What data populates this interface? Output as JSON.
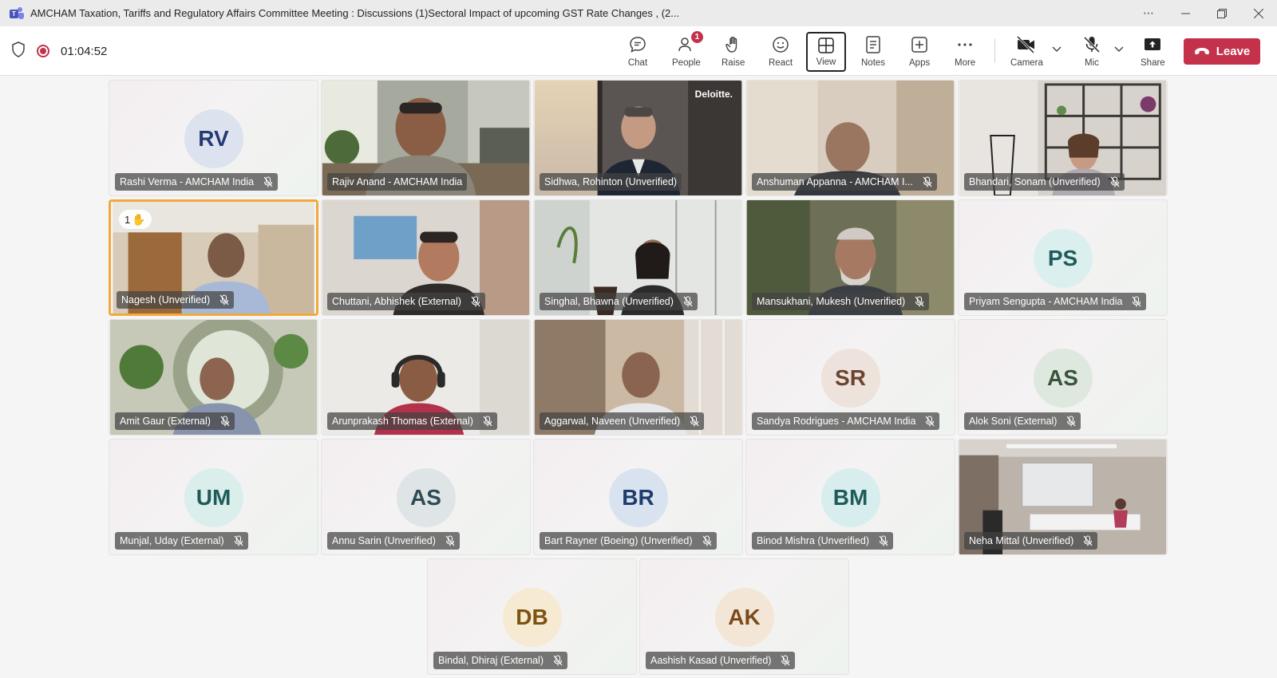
{
  "window": {
    "title": "AMCHAM Taxation, Tariffs and Regulatory Affairs Committee Meeting : Discussions (1)Sectoral Impact of upcoming GST Rate Changes , (2..."
  },
  "toolbar": {
    "timer": "01:04:52",
    "buttons": {
      "chat": "Chat",
      "people": "People",
      "people_badge": "1",
      "raise": "Raise",
      "react": "React",
      "view": "View",
      "notes": "Notes",
      "apps": "Apps",
      "more": "More",
      "camera": "Camera",
      "mic": "Mic",
      "share": "Share"
    },
    "leave_label": "Leave"
  },
  "participants": [
    {
      "name": "Rashi Verma - AMCHAM India",
      "initials": "RV",
      "type": "avatar",
      "avatar_bg": "#dde3ee",
      "avatar_fg": "#243a73"
    },
    {
      "name": "Rajiv Anand - AMCHAM India",
      "type": "video"
    },
    {
      "name": "Sidhwa, Rohinton (Unverified)",
      "type": "video",
      "brand": "Deloitte."
    },
    {
      "name": "Anshuman Appanna - AMCHAM I...",
      "type": "video"
    },
    {
      "name": "Bhandari, Sonam (Unverified)",
      "type": "video"
    },
    {
      "name": "Nagesh (Unverified)",
      "type": "video",
      "hand_count": "1"
    },
    {
      "name": "Chuttani, Abhishek (External)",
      "type": "video"
    },
    {
      "name": "Singhal, Bhawna (Unverified)",
      "type": "video"
    },
    {
      "name": "Mansukhani, Mukesh (Unverified)",
      "type": "video"
    },
    {
      "name": "Priyam Sengupta - AMCHAM India",
      "initials": "PS",
      "type": "avatar",
      "avatar_bg": "#dcefef",
      "avatar_fg": "#1f5c5c"
    },
    {
      "name": "Amit Gaur (External)",
      "type": "video"
    },
    {
      "name": "Arunprakash Thomas (External)",
      "type": "video"
    },
    {
      "name": "Aggarwal, Naveen (Unverified)",
      "type": "video"
    },
    {
      "name": "Sandya Rodrigues - AMCHAM India",
      "initials": "SR",
      "type": "avatar",
      "avatar_bg": "#ede3dc",
      "avatar_fg": "#6b4430"
    },
    {
      "name": "Alok Soni (External)",
      "initials": "AS",
      "type": "avatar",
      "avatar_bg": "#dfe8df",
      "avatar_fg": "#38543a"
    },
    {
      "name": "Munjal, Uday (External)",
      "initials": "UM",
      "type": "avatar",
      "avatar_bg": "#daeeec",
      "avatar_fg": "#1f5c58"
    },
    {
      "name": "Annu Sarin (Unverified)",
      "initials": "AS",
      "type": "avatar",
      "avatar_bg": "#dfe5e6",
      "avatar_fg": "#2e4a55"
    },
    {
      "name": "Bart Rayner (Boeing) (Unverified)",
      "initials": "BR",
      "type": "avatar",
      "avatar_bg": "#d9e3f0",
      "avatar_fg": "#1f3d6b"
    },
    {
      "name": "Binod Mishra (Unverified)",
      "initials": "BM",
      "type": "avatar",
      "avatar_bg": "#d8eeee",
      "avatar_fg": "#1f5a5c"
    },
    {
      "name": "Neha Mittal (Unverified)",
      "type": "video"
    },
    {
      "name": "Bindal, Dhiraj (External)",
      "initials": "DB",
      "type": "avatar",
      "avatar_bg": "#f6ead2",
      "avatar_fg": "#7a5410"
    },
    {
      "name": "Aashish Kasad (Unverified)",
      "initials": "AK",
      "type": "avatar",
      "avatar_bg": "#f4e6d6",
      "avatar_fg": "#7a4a1c"
    }
  ]
}
